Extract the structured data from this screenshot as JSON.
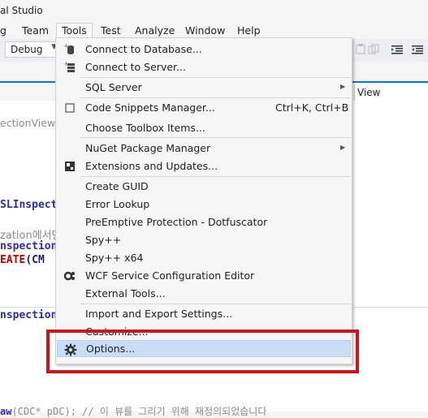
{
  "window": {
    "title": "al Studio"
  },
  "menubar": {
    "items": [
      {
        "label": "g"
      },
      {
        "label": "Team"
      },
      {
        "label": "Tools"
      },
      {
        "label": "Test"
      },
      {
        "label": "Analyze"
      },
      {
        "label": "Window"
      },
      {
        "label": "Help"
      }
    ]
  },
  "toolbar": {
    "configuration": "Debug"
  },
  "editor": {
    "tab_label": "View",
    "lines": {
      "l1": "ectionView",
      "l2": "SLInspect",
      "l3": "zation에서만",
      "l4": "nspection",
      "l5_red": "EATE",
      "l5_rest": "(CM",
      "l6": "nspection",
      "l7_a": "aw",
      "l7_b": "(CDC* pDC); // 이 뷰를 그리기 위해 재정의되었습니다"
    }
  },
  "tools_menu": {
    "items": [
      {
        "label": "Connect to Database...",
        "icon": "database-connect-icon"
      },
      {
        "label": "Connect to Server...",
        "icon": "server-connect-icon"
      },
      {
        "label": "SQL Server",
        "submenu": true
      },
      {
        "label": "Code Snippets Manager...",
        "shortcut": "Ctrl+K, Ctrl+B",
        "icon": "snippet-icon"
      },
      {
        "label": "Choose Toolbox Items..."
      },
      {
        "label": "NuGet Package Manager",
        "submenu": true
      },
      {
        "label": "Extensions and Updates...",
        "icon": "extensions-icon"
      },
      {
        "label": "Create GUID"
      },
      {
        "label": "Error Lookup"
      },
      {
        "label": "PreEmptive Protection - Dotfuscator"
      },
      {
        "label": "Spy++"
      },
      {
        "label": "Spy++ x64"
      },
      {
        "label": "WCF Service Configuration Editor",
        "icon": "wcf-gear-icon"
      },
      {
        "label": "External Tools..."
      },
      {
        "label": "Import and Export Settings..."
      },
      {
        "label": "Customize..."
      },
      {
        "label": "Options...",
        "icon": "gear-icon",
        "selected": true
      }
    ]
  },
  "colors": {
    "highlight_border": "#d0121b",
    "selected_item": "#c9def5",
    "accent": "#007acc"
  }
}
